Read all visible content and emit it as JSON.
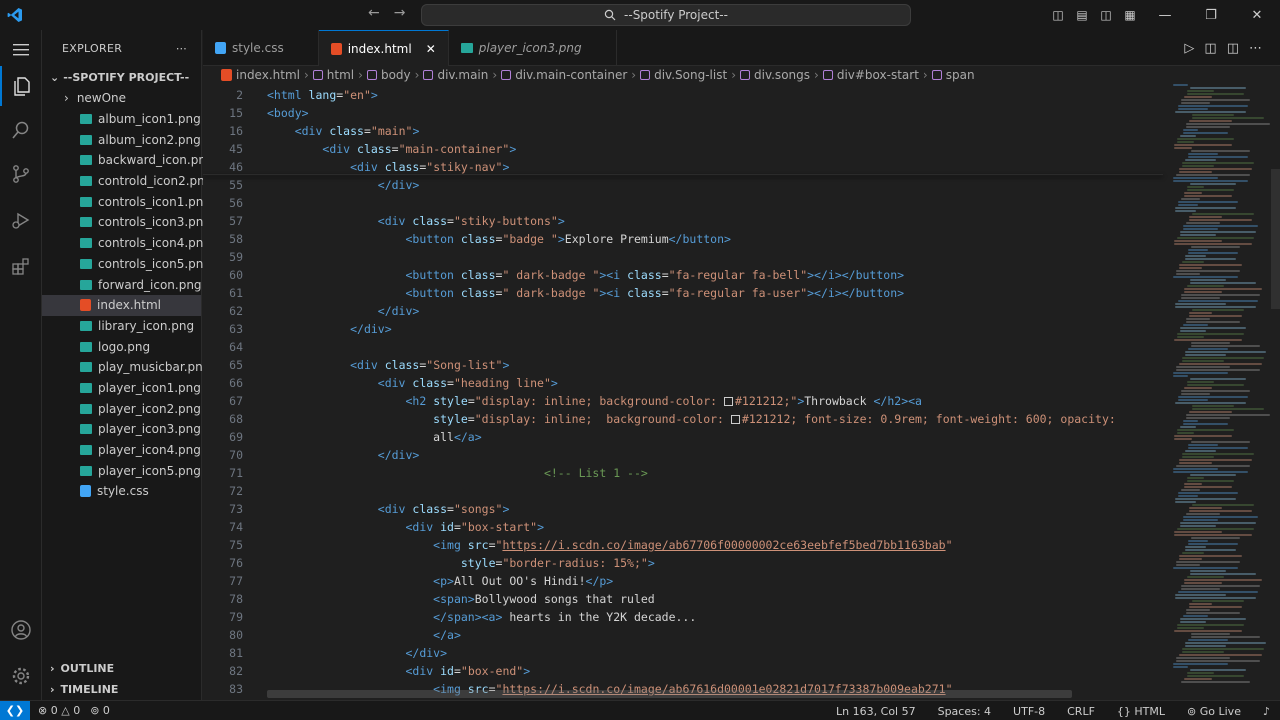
{
  "window": {
    "title": "--Spotify Project--"
  },
  "explorer": {
    "header": "EXPLORER",
    "project": "--SPOTIFY PROJECT--",
    "files": [
      {
        "name": "newOne",
        "type": "folder"
      },
      {
        "name": "album_icon1.png",
        "type": "png"
      },
      {
        "name": "album_icon2.png",
        "type": "png"
      },
      {
        "name": "backward_icon.png",
        "type": "png"
      },
      {
        "name": "controld_icon2.png",
        "type": "png"
      },
      {
        "name": "controls_icon1.png",
        "type": "png"
      },
      {
        "name": "controls_icon3.png",
        "type": "png"
      },
      {
        "name": "controls_icon4.png",
        "type": "png"
      },
      {
        "name": "controls_icon5.png",
        "type": "png"
      },
      {
        "name": "forward_icon.png",
        "type": "png"
      },
      {
        "name": "index.html",
        "type": "html",
        "selected": true
      },
      {
        "name": "library_icon.png",
        "type": "png"
      },
      {
        "name": "logo.png",
        "type": "png"
      },
      {
        "name": "play_musicbar.png",
        "type": "png"
      },
      {
        "name": "player_icon1.png",
        "type": "png"
      },
      {
        "name": "player_icon2.png",
        "type": "png"
      },
      {
        "name": "player_icon3.png",
        "type": "png"
      },
      {
        "name": "player_icon4.png",
        "type": "png"
      },
      {
        "name": "player_icon5.png",
        "type": "png"
      },
      {
        "name": "style.css",
        "type": "css"
      }
    ],
    "outline": "OUTLINE",
    "timeline": "TIMELINE"
  },
  "tabs": [
    {
      "label": "style.css",
      "kind": "css"
    },
    {
      "label": "index.html",
      "kind": "html",
      "active": true
    },
    {
      "label": "player_icon3.png",
      "kind": "png",
      "preview": true
    }
  ],
  "breadcrumb": [
    "index.html",
    "html",
    "body",
    "div.main",
    "div.main-container",
    "div.Song-list",
    "div.songs",
    "div#box-start",
    "span"
  ],
  "editor": {
    "lines": [
      {
        "n": "2",
        "tokens": [
          [
            "t",
            "<html "
          ],
          [
            "a",
            "lang"
          ],
          [
            "x",
            "="
          ],
          [
            "s",
            "\"en\""
          ],
          [
            "t",
            ">"
          ]
        ]
      },
      {
        "n": "15",
        "tokens": [
          [
            "t",
            "<body>"
          ]
        ]
      },
      {
        "n": "16",
        "tokens": [
          [
            "x",
            "    "
          ],
          [
            "t",
            "<div "
          ],
          [
            "a",
            "class"
          ],
          [
            "x",
            "="
          ],
          [
            "s",
            "\"main\""
          ],
          [
            "t",
            ">"
          ]
        ]
      },
      {
        "n": "45",
        "tokens": [
          [
            "x",
            "        "
          ],
          [
            "t",
            "<div "
          ],
          [
            "a",
            "class"
          ],
          [
            "x",
            "="
          ],
          [
            "s",
            "\"main-container\""
          ],
          [
            "t",
            ">"
          ]
        ]
      },
      {
        "n": "46",
        "tokens": [
          [
            "x",
            "            "
          ],
          [
            "t",
            "<div "
          ],
          [
            "a",
            "class"
          ],
          [
            "x",
            "="
          ],
          [
            "s",
            "\"stiky-nav\""
          ],
          [
            "t",
            ">"
          ]
        ]
      },
      {
        "n": "55",
        "tokens": [
          [
            "x",
            "                "
          ],
          [
            "t",
            "</div>"
          ]
        ]
      },
      {
        "n": "56",
        "tokens": []
      },
      {
        "n": "57",
        "tokens": [
          [
            "x",
            "                "
          ],
          [
            "t",
            "<div "
          ],
          [
            "a",
            "class"
          ],
          [
            "x",
            "="
          ],
          [
            "s",
            "\"stiky-buttons\""
          ],
          [
            "t",
            ">"
          ]
        ]
      },
      {
        "n": "58",
        "tokens": [
          [
            "x",
            "                    "
          ],
          [
            "t",
            "<button "
          ],
          [
            "a",
            "class"
          ],
          [
            "x",
            "="
          ],
          [
            "s",
            "\"badge \""
          ],
          [
            "t",
            ">"
          ],
          [
            "x",
            "Explore Premium"
          ],
          [
            "t",
            "</button>"
          ]
        ]
      },
      {
        "n": "59",
        "tokens": []
      },
      {
        "n": "60",
        "tokens": [
          [
            "x",
            "                    "
          ],
          [
            "t",
            "<button "
          ],
          [
            "a",
            "class"
          ],
          [
            "x",
            "="
          ],
          [
            "s",
            "\" dark-badge \""
          ],
          [
            "t",
            "><i "
          ],
          [
            "a",
            "class"
          ],
          [
            "x",
            "="
          ],
          [
            "s",
            "\"fa-regular fa-bell\""
          ],
          [
            "t",
            "></i></button>"
          ]
        ]
      },
      {
        "n": "61",
        "tokens": [
          [
            "x",
            "                    "
          ],
          [
            "t",
            "<button "
          ],
          [
            "a",
            "class"
          ],
          [
            "x",
            "="
          ],
          [
            "s",
            "\" dark-badge \""
          ],
          [
            "t",
            "><i "
          ],
          [
            "a",
            "class"
          ],
          [
            "x",
            "="
          ],
          [
            "s",
            "\"fa-regular fa-user\""
          ],
          [
            "t",
            "></i></button>"
          ]
        ]
      },
      {
        "n": "62",
        "tokens": [
          [
            "x",
            "                "
          ],
          [
            "t",
            "</div>"
          ]
        ]
      },
      {
        "n": "63",
        "tokens": [
          [
            "x",
            "            "
          ],
          [
            "t",
            "</div>"
          ]
        ]
      },
      {
        "n": "64",
        "tokens": []
      },
      {
        "n": "65",
        "tokens": [
          [
            "x",
            "            "
          ],
          [
            "t",
            "<div "
          ],
          [
            "a",
            "class"
          ],
          [
            "x",
            "="
          ],
          [
            "s",
            "\"Song-list\""
          ],
          [
            "t",
            ">"
          ]
        ]
      },
      {
        "n": "66",
        "tokens": [
          [
            "x",
            "                "
          ],
          [
            "t",
            "<div "
          ],
          [
            "a",
            "class"
          ],
          [
            "x",
            "="
          ],
          [
            "s",
            "\"heading line\""
          ],
          [
            "t",
            ">"
          ]
        ]
      },
      {
        "n": "67",
        "tokens": [
          [
            "x",
            "                    "
          ],
          [
            "t",
            "<h2 "
          ],
          [
            "a",
            "style"
          ],
          [
            "x",
            "="
          ],
          [
            "s",
            "\"display: inline; background-color: "
          ],
          [
            "w",
            ""
          ],
          [
            "s",
            "#121212;\""
          ],
          [
            "t",
            ">"
          ],
          [
            "x",
            "Throwback "
          ],
          [
            "t",
            "</h2><a"
          ]
        ]
      },
      {
        "n": "68",
        "tokens": [
          [
            "x",
            "                        "
          ],
          [
            "a",
            "style"
          ],
          [
            "x",
            "="
          ],
          [
            "s",
            "\"display: inline;  background-color: "
          ],
          [
            "w",
            ""
          ],
          [
            "s",
            "#121212; font-size: 0.9rem; font-weight: 600; opacity:"
          ]
        ]
      },
      {
        "n": "69",
        "tokens": [
          [
            "x",
            "                        "
          ],
          [
            "x",
            "all"
          ],
          [
            "t",
            "</a>"
          ]
        ]
      },
      {
        "n": "70",
        "tokens": [
          [
            "x",
            "                "
          ],
          [
            "t",
            "</div>"
          ]
        ]
      },
      {
        "n": "71",
        "tokens": [
          [
            "x",
            "                                        "
          ],
          [
            "c",
            "<!-- List 1 -->"
          ]
        ]
      },
      {
        "n": "72",
        "tokens": []
      },
      {
        "n": "73",
        "tokens": [
          [
            "x",
            "                "
          ],
          [
            "t",
            "<div "
          ],
          [
            "a",
            "class"
          ],
          [
            "x",
            "="
          ],
          [
            "s",
            "\"songs\""
          ],
          [
            "t",
            ">"
          ]
        ]
      },
      {
        "n": "74",
        "tokens": [
          [
            "x",
            "                    "
          ],
          [
            "t",
            "<div "
          ],
          [
            "a",
            "id"
          ],
          [
            "x",
            "="
          ],
          [
            "s",
            "\"box-start\""
          ],
          [
            "t",
            ">"
          ]
        ]
      },
      {
        "n": "75",
        "tokens": [
          [
            "x",
            "                        "
          ],
          [
            "t",
            "<img "
          ],
          [
            "a",
            "src"
          ],
          [
            "x",
            "="
          ],
          [
            "s",
            "\""
          ],
          [
            "u",
            "https://i.scdn.co/image/ab67706f00000002ce63eebfef5bed7bb1163bab"
          ],
          [
            "s",
            "\""
          ]
        ]
      },
      {
        "n": "76",
        "tokens": [
          [
            "x",
            "                            "
          ],
          [
            "a",
            "style"
          ],
          [
            "x",
            "="
          ],
          [
            "s",
            "\"border-radius: 15%;\""
          ],
          [
            "t",
            ">"
          ]
        ]
      },
      {
        "n": "77",
        "tokens": [
          [
            "x",
            "                        "
          ],
          [
            "t",
            "<p>"
          ],
          [
            "x",
            "All Out OO's Hindi!"
          ],
          [
            "t",
            "</p>"
          ]
        ]
      },
      {
        "n": "78",
        "tokens": [
          [
            "x",
            "                        "
          ],
          [
            "t",
            "<span>"
          ],
          [
            "x",
            "Bollywood songs that ruled"
          ]
        ]
      },
      {
        "n": "79",
        "tokens": [
          [
            "x",
            "                        "
          ],
          [
            "t",
            "</span><a>"
          ],
          [
            "x",
            " hearts in the Y2K decade..."
          ]
        ]
      },
      {
        "n": "80",
        "tokens": [
          [
            "x",
            "                        "
          ],
          [
            "t",
            "</a>"
          ]
        ]
      },
      {
        "n": "81",
        "tokens": [
          [
            "x",
            "                    "
          ],
          [
            "t",
            "</div>"
          ]
        ]
      },
      {
        "n": "82",
        "tokens": [
          [
            "x",
            "                    "
          ],
          [
            "t",
            "<div "
          ],
          [
            "a",
            "id"
          ],
          [
            "x",
            "="
          ],
          [
            "s",
            "\"box-end\""
          ],
          [
            "t",
            ">"
          ]
        ]
      },
      {
        "n": "83",
        "tokens": [
          [
            "x",
            "                        "
          ],
          [
            "t",
            "<img "
          ],
          [
            "a",
            "src"
          ],
          [
            "x",
            "="
          ],
          [
            "s",
            "\""
          ],
          [
            "u",
            "https://i.scdn.co/image/ab67616d00001e02821d7017f73387b009eab271"
          ],
          [
            "s",
            "\""
          ]
        ]
      }
    ]
  },
  "status": {
    "errors": "0",
    "warnings": "0",
    "ports": "0",
    "position": "Ln 163, Col 57",
    "spaces": "Spaces: 4",
    "encoding": "UTF-8",
    "eol": "CRLF",
    "language": "HTML",
    "golive": "Go Live"
  },
  "colors": {
    "accent": "#0078d4",
    "tag": "#569cd6",
    "attr": "#9cdcfe",
    "string": "#ce9178",
    "comment": "#6a9955"
  }
}
